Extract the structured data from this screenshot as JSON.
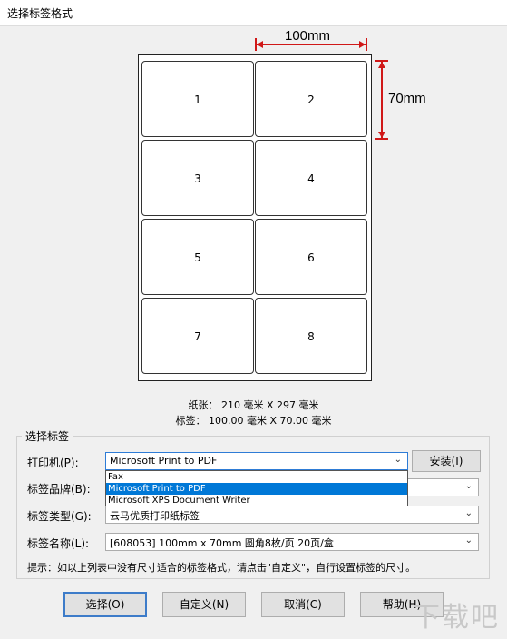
{
  "window": {
    "title": "选择标签格式"
  },
  "preview": {
    "width_dim": "100mm",
    "height_dim": "70mm",
    "labels": [
      "1",
      "2",
      "3",
      "4",
      "5",
      "6",
      "7",
      "8"
    ]
  },
  "paper_info": "纸张：  210 毫米 X  297 毫米",
  "label_info": "标签：  100.00 毫米 X 70.00 毫米",
  "group": {
    "title": "选择标签",
    "printer": {
      "label": "打印机(P):",
      "value": "Microsoft Print to PDF",
      "install_label": "安装(I)"
    },
    "printer_options": [
      "Fax",
      "Microsoft Print to PDF",
      "Microsoft XPS Document Writer"
    ],
    "brand": {
      "label": "标签品牌(B):",
      "value": ""
    },
    "type": {
      "label": "标签类型(G):",
      "value": "云马优质打印纸标签"
    },
    "name": {
      "label": "标签名称(L):",
      "value": "[608053] 100mm x 70mm 圆角8枚/页 20页/盒"
    }
  },
  "hint": "提示：如以上列表中没有尺寸适合的标签格式，请点击\"自定义\"，自行设置标签的尺寸。",
  "buttons": {
    "select": "选择(O)",
    "custom": "自定义(N)",
    "cancel": "取消(C)",
    "help": "帮助(H)"
  },
  "watermark": "下载吧"
}
